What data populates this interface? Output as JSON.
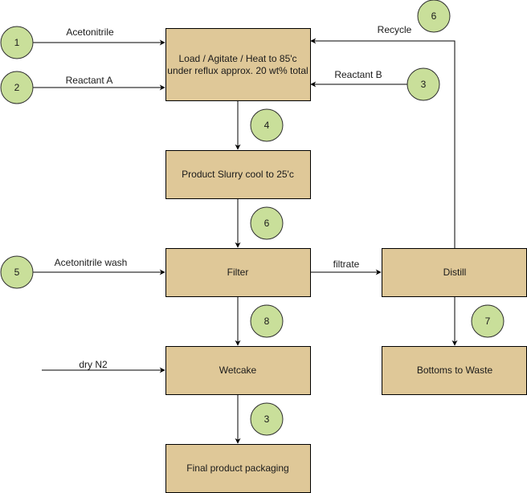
{
  "diagram": {
    "colors": {
      "process_fill": "#dfc898",
      "stream_fill": "#c9df9a",
      "stroke": "#000000"
    },
    "processes": {
      "reactor": {
        "line1": "Load / Agitate / Heat to 85'c",
        "line2": "under reflux approx. 20 wt% total"
      },
      "slurry": {
        "label": "Product Slurry cool to 25'c"
      },
      "filter": {
        "label": "Filter"
      },
      "distill": {
        "label": "Distill"
      },
      "wetcake": {
        "label": "Wetcake"
      },
      "waste": {
        "label": "Bottoms to Waste"
      },
      "packaging": {
        "label": "Final product packaging"
      }
    },
    "streams": {
      "s1": "1",
      "s2": "2",
      "s3_reactant_b": "3",
      "s4": "4",
      "s6_recycle": "6",
      "s6_slurry": "6",
      "s5": "5",
      "s8": "8",
      "s7": "7",
      "s3_packaging": "3"
    },
    "edge_labels": {
      "acetonitrile": "Acetonitrile",
      "reactant_a": "Reactant A",
      "reactant_b": "Reactant B",
      "recycle": "Recycle",
      "acetonitrile_wash": "Acetonitrile wash",
      "filtrate": "filtrate",
      "dry_n2": "dry N2"
    }
  }
}
